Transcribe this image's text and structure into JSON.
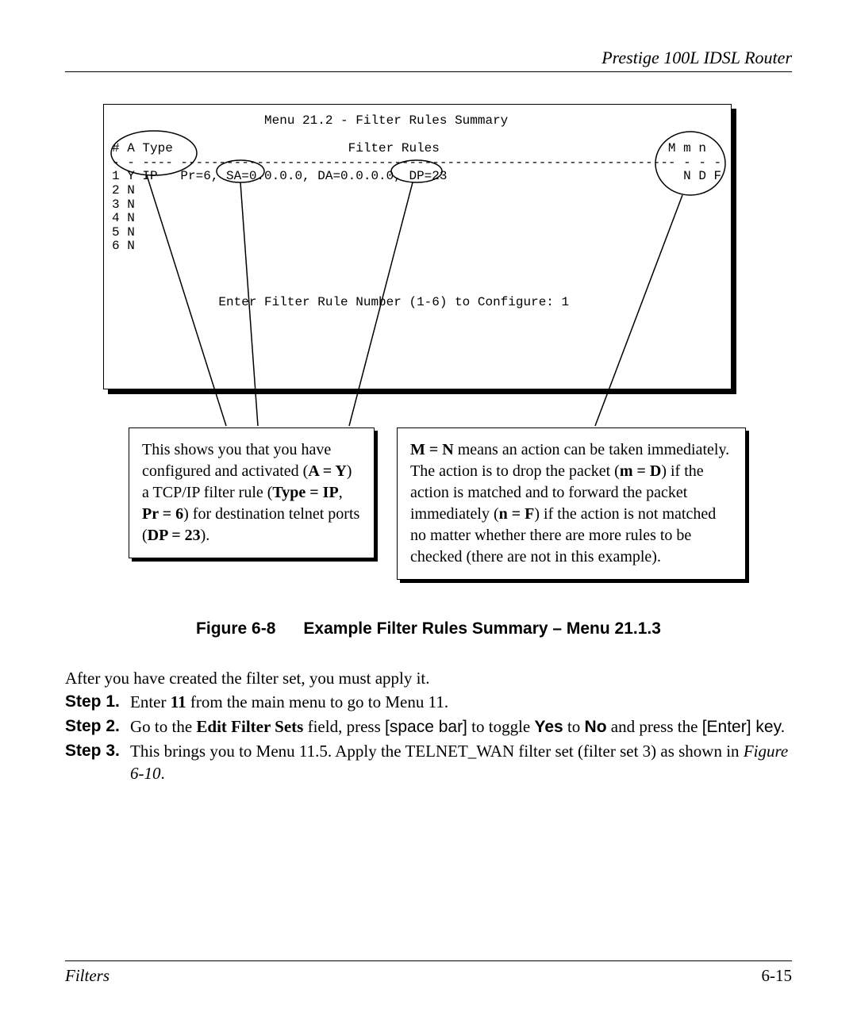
{
  "header": {
    "title": "Prestige 100L IDSL Router"
  },
  "terminal": {
    "title": "Menu 21.2 - Filter Rules Summary",
    "cols": "# A Type                       Filter Rules                              M m n",
    "sep": "- - ---- ----------------------------------------------------------------- - - -",
    "r1": "1 Y IP   Pr=6, SA=0.0.0.0, DA=0.0.0.0, DP=23                               N D F",
    "r2": "2 N",
    "r3": "3 N",
    "r4": "4 N",
    "r5": "5 N",
    "r6": "6 N",
    "prompt": "Enter Filter Rule Number (1-6) to Configure: 1"
  },
  "callouts": {
    "left": {
      "t1": "This shows you that you have configured and activated (",
      "b1": "A = Y",
      "t2": ") a TCP/IP filter rule (",
      "b2": "Type = IP",
      "t3": ", ",
      "b3": "Pr = 6",
      "t4": ") for destination telnet ports (",
      "b4": "DP = 23",
      "t5": ")."
    },
    "right": {
      "b1": "M = N",
      "t1": " means an action can be taken immediately. The action is to drop the packet (",
      "b2": "m = D",
      "t2": ") if the action is matched and to forward the packet immediately (",
      "b3": "n = F",
      "t3": ") if the action is not matched no matter whether there are more rules to be checked (there are not in this example)."
    }
  },
  "caption": {
    "label": "Figure 6-8",
    "text": "Example Filter Rules Summary – Menu 21.1.3"
  },
  "body": {
    "intro": "After you have created the filter set, you must apply it."
  },
  "steps": {
    "s1": {
      "label": "Step 1.",
      "a": "Enter ",
      "b": "11",
      "c": " from the main menu to go to Menu 11."
    },
    "s2": {
      "label": "Step 2.",
      "a": "Go to the ",
      "b": "Edit Filter Sets",
      "c": " field, press ",
      "d": "[space bar]",
      "e": " to toggle ",
      "f": "Yes",
      "g": " to ",
      "h": "No",
      "i": " and press the ",
      "j": "[Enter]",
      "k": " key."
    },
    "s3": {
      "label": "Step 3.",
      "a": "This brings you to Menu 11.5. Apply the TELNET_WAN filter set (filter set 3) as shown in ",
      "b": "Figure 6-10",
      "c": "."
    }
  },
  "footer": {
    "left": "Filters",
    "right": "6-15"
  }
}
